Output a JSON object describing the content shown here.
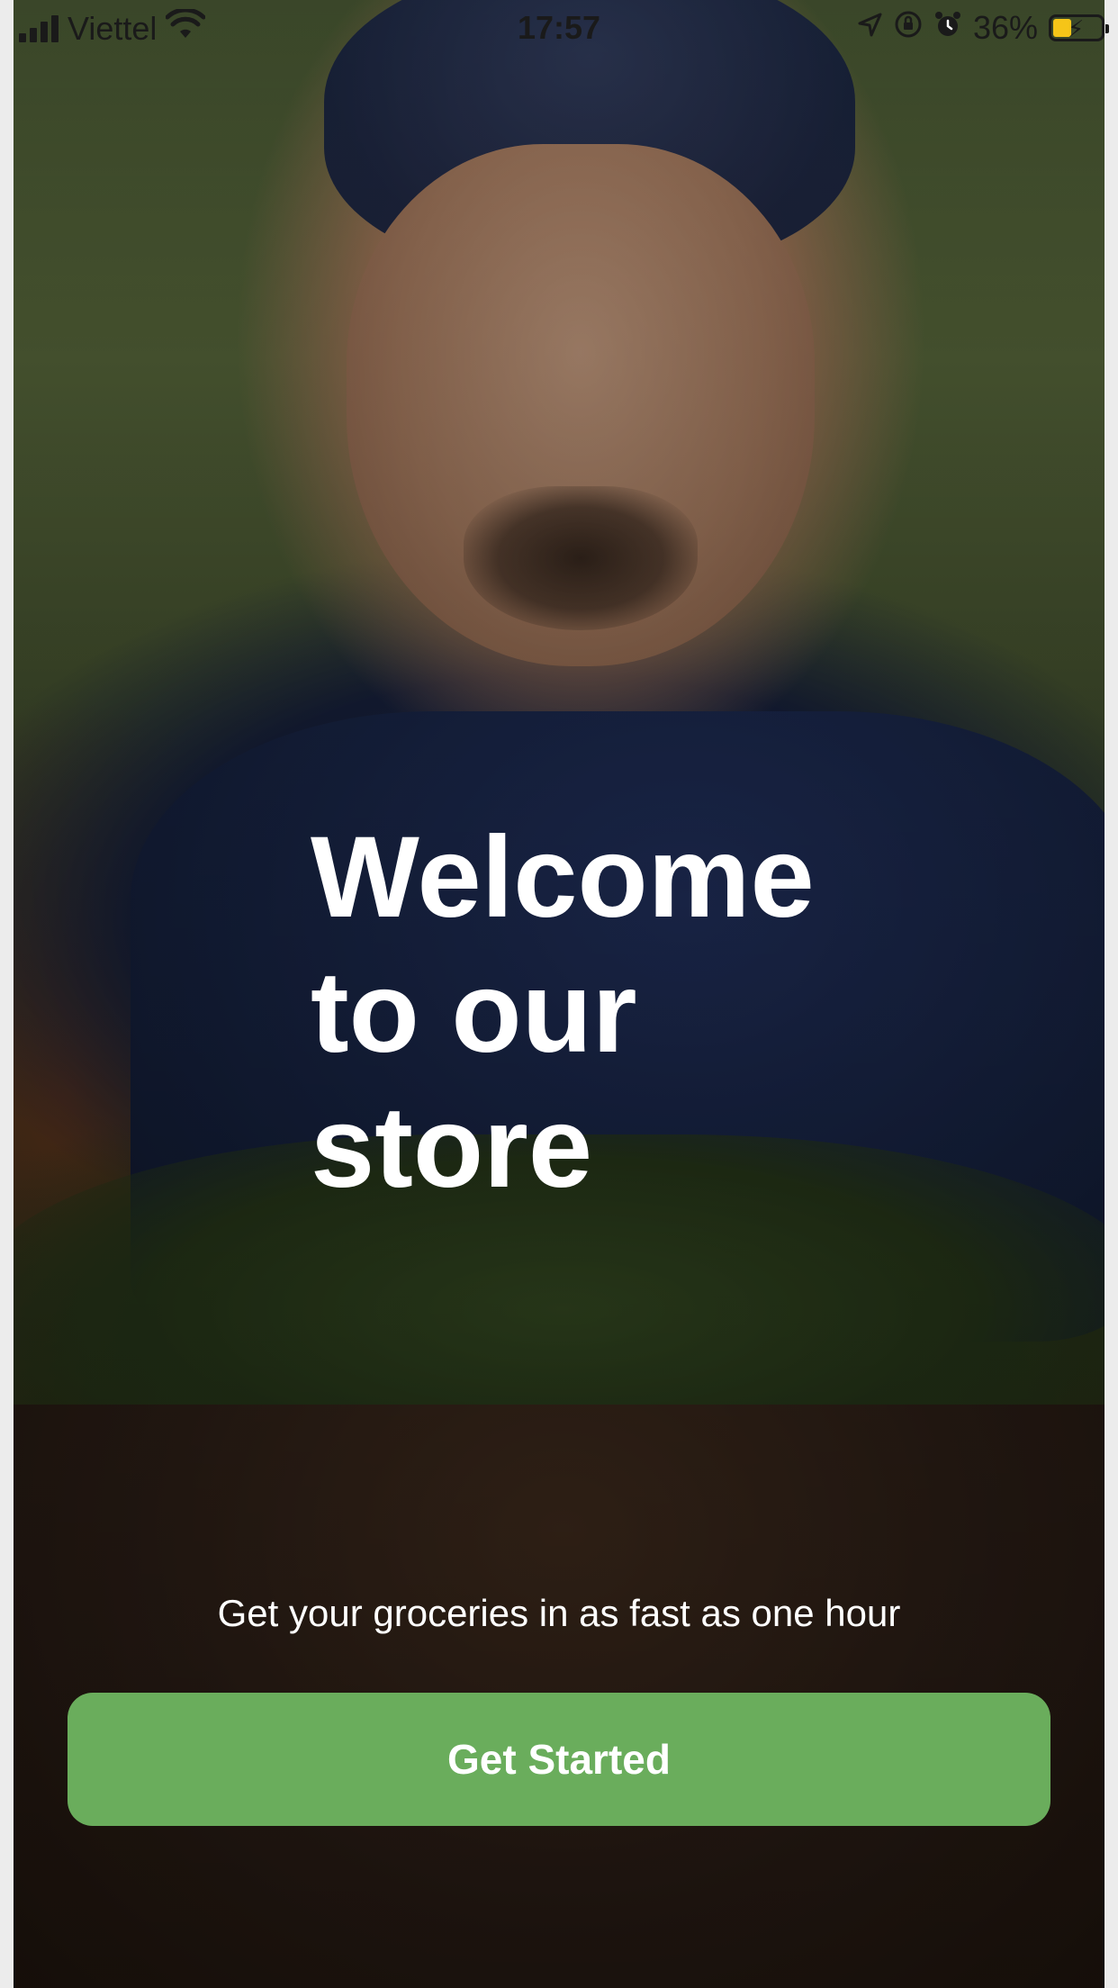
{
  "status_bar": {
    "carrier": "Viettel",
    "time": "17:57",
    "battery_percent": "36%",
    "battery_level": 0.36,
    "battery_color": "#f5c518",
    "icons": [
      "signal-icon",
      "wifi-icon",
      "location-icon",
      "orientation-lock-icon",
      "alarm-icon",
      "battery-charging-icon"
    ]
  },
  "hero": {
    "headline_lines": [
      "Welcome",
      "to our",
      "store"
    ],
    "subtitle": "Get your groceries in as fast as one hour"
  },
  "cta": {
    "label": "Get Started",
    "color": "#6aad5c"
  }
}
